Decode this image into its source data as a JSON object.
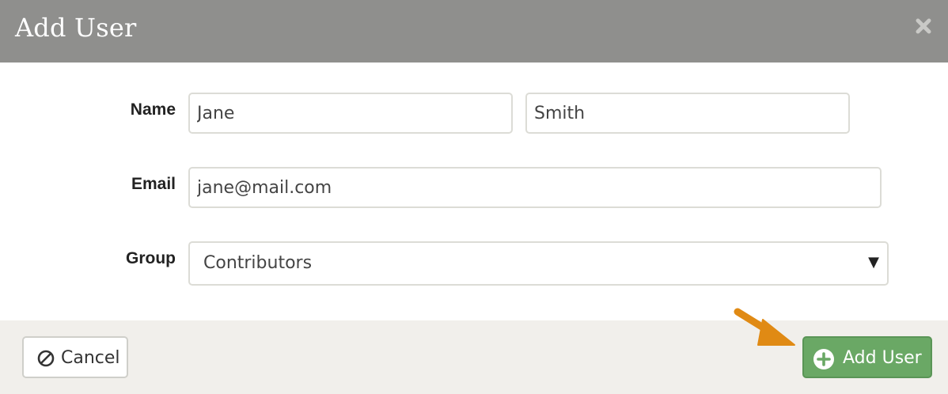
{
  "dialog": {
    "title": "Add User",
    "close_icon": "close-icon"
  },
  "form": {
    "name_label": "Name",
    "first_name_value": "Jane",
    "last_name_value": "Smith",
    "email_label": "Email",
    "email_value": "jane@mail.com",
    "group_label": "Group",
    "group_selected": "Contributors",
    "group_arrow": "▼"
  },
  "footer": {
    "cancel_label": "Cancel",
    "cancel_icon": "ban-icon",
    "add_label": "Add User",
    "add_icon": "plus-circle-icon"
  },
  "annotation": {
    "pointer_icon": "arrow-pointer-icon",
    "color": "#e08a14"
  },
  "colors": {
    "header_bg": "#8f8f8d",
    "footer_bg": "#f1efeb",
    "primary_green": "#6aa865"
  }
}
